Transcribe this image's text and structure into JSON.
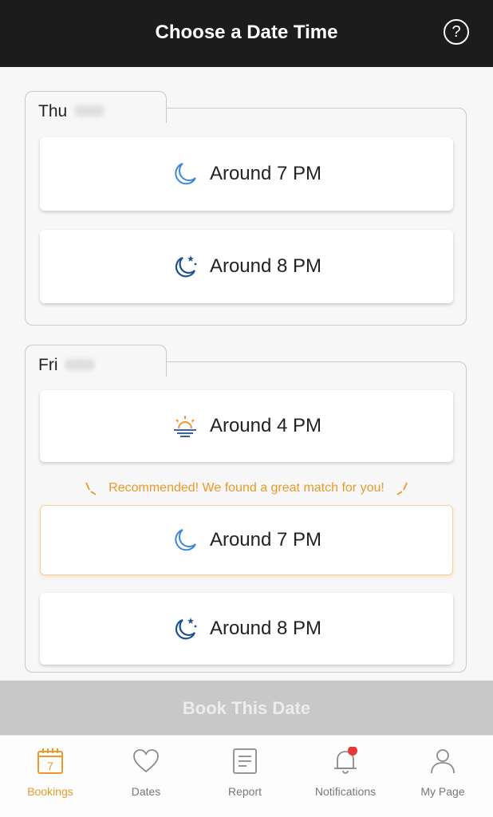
{
  "header": {
    "title": "Choose a Date Time",
    "help_icon": "?"
  },
  "groups": [
    {
      "day": "Thu",
      "slots": [
        {
          "label": "Around 7 PM",
          "icon": "moon-icon"
        },
        {
          "label": "Around 8 PM",
          "icon": "moon-stars-icon"
        }
      ]
    },
    {
      "day": "Fri",
      "slots": [
        {
          "label": "Around 4 PM",
          "icon": "sunset-icon"
        },
        {
          "label": "Around 7 PM",
          "icon": "moon-icon",
          "recommended": true
        },
        {
          "label": "Around 8 PM",
          "icon": "moon-stars-icon"
        }
      ],
      "recommendation": "Recommended!  We found a great match for you!"
    }
  ],
  "book_button": "Book This Date",
  "tabbar": [
    {
      "label": "Bookings",
      "icon": "calendar-icon",
      "badge": "7",
      "active": true
    },
    {
      "label": "Dates",
      "icon": "heart-icon"
    },
    {
      "label": "Report",
      "icon": "report-icon"
    },
    {
      "label": "Notifications",
      "icon": "bell-icon",
      "has_notification": true
    },
    {
      "label": "My Page",
      "icon": "person-icon"
    }
  ],
  "colors": {
    "accent": "#e89a2a",
    "moon": "#3f88d8",
    "moon_stars": "#1f4f8f",
    "header": "#1c1c1c",
    "notification_dot": "#e53935"
  }
}
